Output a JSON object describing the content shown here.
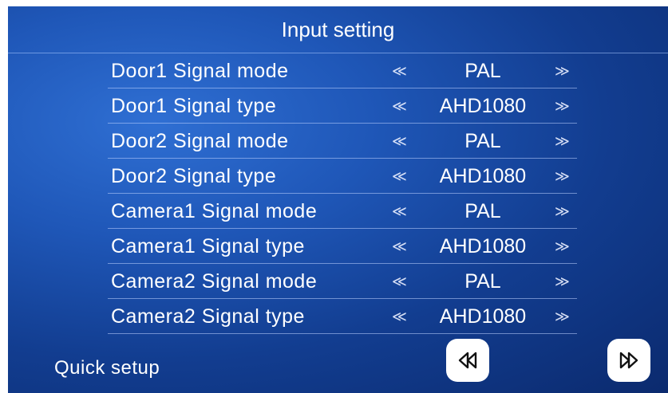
{
  "title": "Input setting",
  "rows": [
    {
      "label": "Door1 Signal mode",
      "value": "PAL"
    },
    {
      "label": "Door1 Signal type",
      "value": "AHD1080"
    },
    {
      "label": "Door2 Signal mode",
      "value": "PAL"
    },
    {
      "label": "Door2 Signal type",
      "value": "AHD1080"
    },
    {
      "label": "Camera1 Signal mode",
      "value": "PAL"
    },
    {
      "label": "Camera1 Signal type",
      "value": "AHD1080"
    },
    {
      "label": "Camera2 Signal mode",
      "value": "PAL"
    },
    {
      "label": "Camera2 Signal type",
      "value": "AHD1080"
    }
  ],
  "arrows": {
    "left": "≪",
    "right": "≫"
  },
  "footer": {
    "label": "Quick setup"
  },
  "icons": {
    "prev": "double-chevron-left-icon",
    "next": "double-chevron-right-icon"
  },
  "colors": {
    "background": "#1a4aa8",
    "text": "#ffffff",
    "button": "#ffffff"
  }
}
